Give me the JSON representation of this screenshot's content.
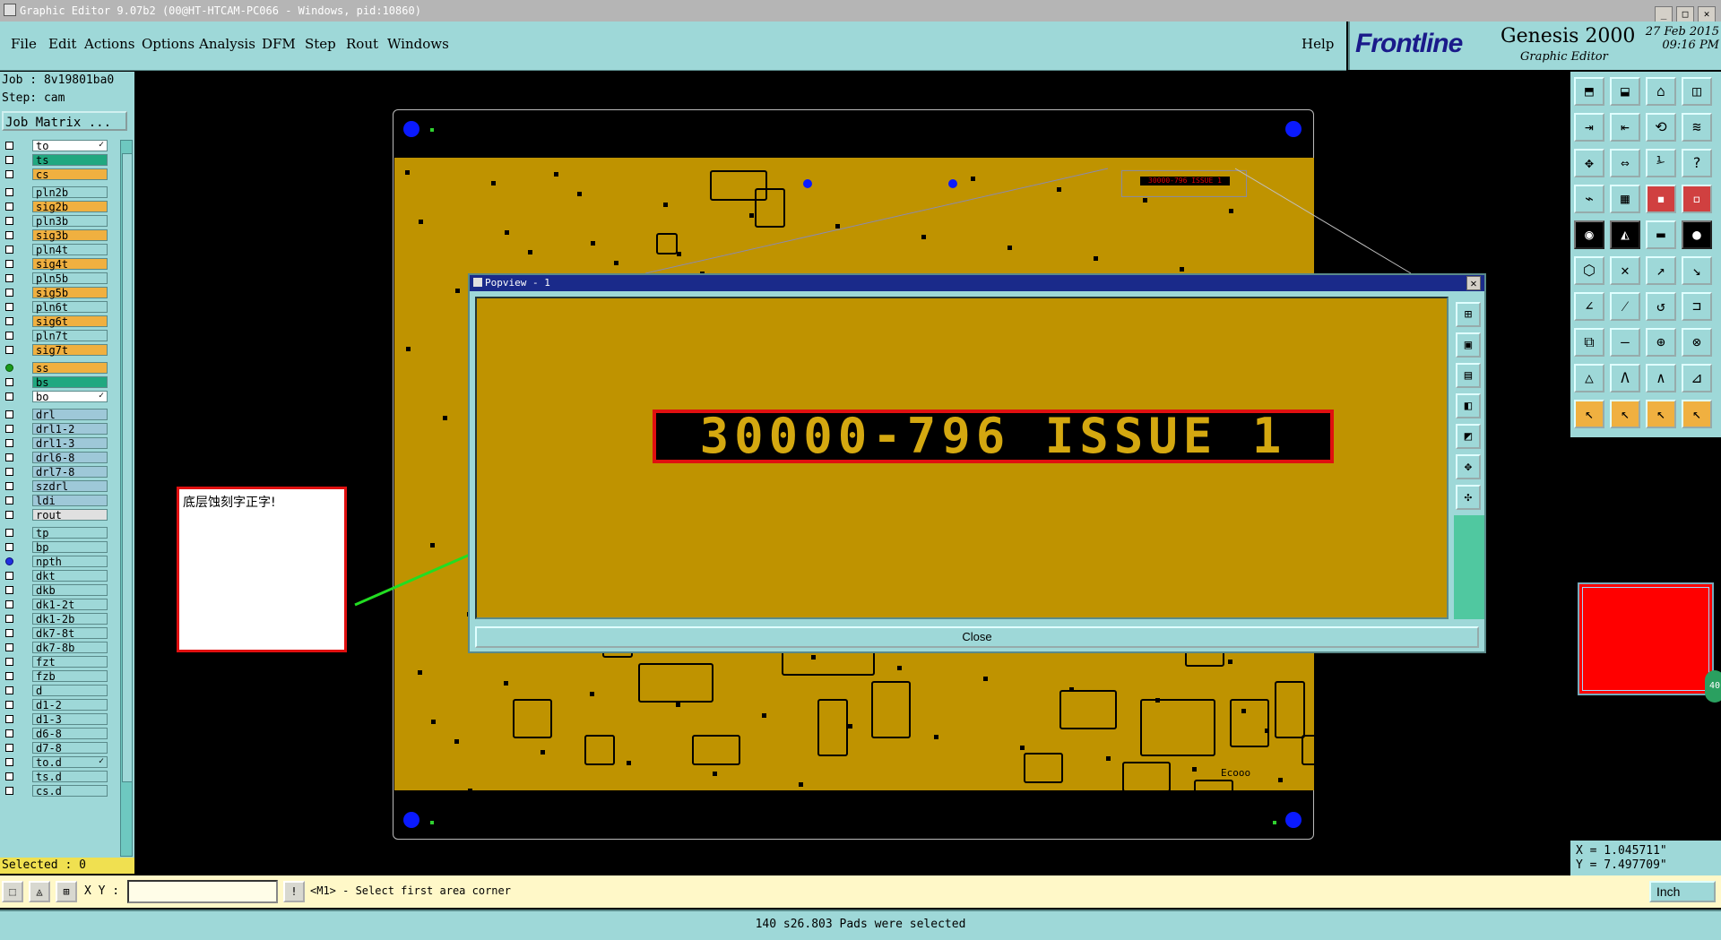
{
  "window": {
    "title": "Graphic Editor 9.07b2 (00@HT-HTCAM-PC066 - Windows, pid:10860)"
  },
  "menu": {
    "items": [
      "File",
      "Edit",
      "Actions",
      "Options",
      "Analysis",
      "DFM",
      "Step",
      "Rout",
      "Windows"
    ],
    "help": "Help"
  },
  "brand": {
    "logo": "Frontline",
    "product": "Genesis 2000",
    "subtitle": "Graphic Editor",
    "date": "27 Feb 2015",
    "time": "09:16 PM"
  },
  "job": {
    "job_line": "Job : 8v19801ba0",
    "step_line": "Step: cam",
    "matrix_button": "Job Matrix ..."
  },
  "layers": [
    {
      "name": "to",
      "color": "#ffffff",
      "state": "box",
      "tick": true
    },
    {
      "name": "ts",
      "color": "#20a880",
      "state": "box"
    },
    {
      "name": "cs",
      "color": "#f0b040",
      "state": "box"
    },
    {
      "name": "pln2b",
      "color": "#9ed8d8",
      "state": "box"
    },
    {
      "name": "sig2b",
      "color": "#f0b040",
      "state": "box"
    },
    {
      "name": "pln3b",
      "color": "#9ed8d8",
      "state": "box"
    },
    {
      "name": "sig3b",
      "color": "#f0b040",
      "state": "box"
    },
    {
      "name": "pln4t",
      "color": "#9ed8d8",
      "state": "box"
    },
    {
      "name": "sig4t",
      "color": "#f0b040",
      "state": "box"
    },
    {
      "name": "pln5b",
      "color": "#9ed8d8",
      "state": "box"
    },
    {
      "name": "sig5b",
      "color": "#f0b040",
      "state": "box"
    },
    {
      "name": "pln6t",
      "color": "#9ed8d8",
      "state": "box"
    },
    {
      "name": "sig6t",
      "color": "#f0b040",
      "state": "box"
    },
    {
      "name": "pln7t",
      "color": "#9ed8d8",
      "state": "box"
    },
    {
      "name": "sig7t",
      "color": "#f0b040",
      "state": "box"
    },
    {
      "name": "ss",
      "color": "#f0b040",
      "state": "on"
    },
    {
      "name": "bs",
      "color": "#20a880",
      "state": "box"
    },
    {
      "name": "bo",
      "color": "#ffffff",
      "state": "box",
      "tick": true
    },
    {
      "name": "drl",
      "color": "#9ec8d8",
      "state": "box"
    },
    {
      "name": "drl1-2",
      "color": "#9ec8d8",
      "state": "box"
    },
    {
      "name": "drl1-3",
      "color": "#9ec8d8",
      "state": "box"
    },
    {
      "name": "drl6-8",
      "color": "#9ec8d8",
      "state": "box"
    },
    {
      "name": "drl7-8",
      "color": "#9ec8d8",
      "state": "box"
    },
    {
      "name": "szdrl",
      "color": "#9ec8d8",
      "state": "box"
    },
    {
      "name": "ldi",
      "color": "#9ec8d8",
      "state": "box"
    },
    {
      "name": "rout",
      "color": "#e0e0e0",
      "state": "box"
    },
    {
      "name": "tp",
      "color": "#9ed8d8",
      "state": "box"
    },
    {
      "name": "bp",
      "color": "#9ed8d8",
      "state": "box"
    },
    {
      "name": "npth",
      "color": "#9ed8d8",
      "state": "blue"
    },
    {
      "name": "dkt",
      "color": "#9ed8d8",
      "state": "box"
    },
    {
      "name": "dkb",
      "color": "#9ed8d8",
      "state": "box"
    },
    {
      "name": "dk1-2t",
      "color": "#9ed8d8",
      "state": "box"
    },
    {
      "name": "dk1-2b",
      "color": "#9ed8d8",
      "state": "box"
    },
    {
      "name": "dk7-8t",
      "color": "#9ed8d8",
      "state": "box"
    },
    {
      "name": "dk7-8b",
      "color": "#9ed8d8",
      "state": "box"
    },
    {
      "name": "fzt",
      "color": "#9ed8d8",
      "state": "box"
    },
    {
      "name": "fzb",
      "color": "#9ed8d8",
      "state": "box"
    },
    {
      "name": "d",
      "color": "#9ed8d8",
      "state": "box"
    },
    {
      "name": "d1-2",
      "color": "#9ed8d8",
      "state": "box"
    },
    {
      "name": "d1-3",
      "color": "#9ed8d8",
      "state": "box"
    },
    {
      "name": "d6-8",
      "color": "#9ed8d8",
      "state": "box"
    },
    {
      "name": "d7-8",
      "color": "#9ed8d8",
      "state": "box"
    },
    {
      "name": "to.d",
      "color": "#9ed8d8",
      "state": "box",
      "tick": true
    },
    {
      "name": "ts.d",
      "color": "#9ed8d8",
      "state": "box"
    },
    {
      "name": "cs.d",
      "color": "#9ed8d8",
      "state": "box"
    }
  ],
  "selected": "Selected : 0",
  "note": {
    "text": "底层蚀刻字正字!"
  },
  "popview": {
    "title": "Popview - 1",
    "text": "30000-796 ISSUE 1",
    "close_label": "Close",
    "close_x": "✕"
  },
  "board": {
    "mini_label": "30000-796 ISSUE 1",
    "corner_label": "Ecooo"
  },
  "coords": {
    "x": "X = 1.045711\"",
    "y": "Y = 7.497709\""
  },
  "bottom": {
    "xy_label": "X Y :",
    "prompt": "<M1> - Select first area corner",
    "unit": "Inch"
  },
  "status": "140 s26.803 Pads were selected",
  "colors": {
    "menu_bg": "#9ed8d8",
    "board": "#bf9300",
    "fiducial": "#0a1aff",
    "highlight": "#e01010"
  }
}
